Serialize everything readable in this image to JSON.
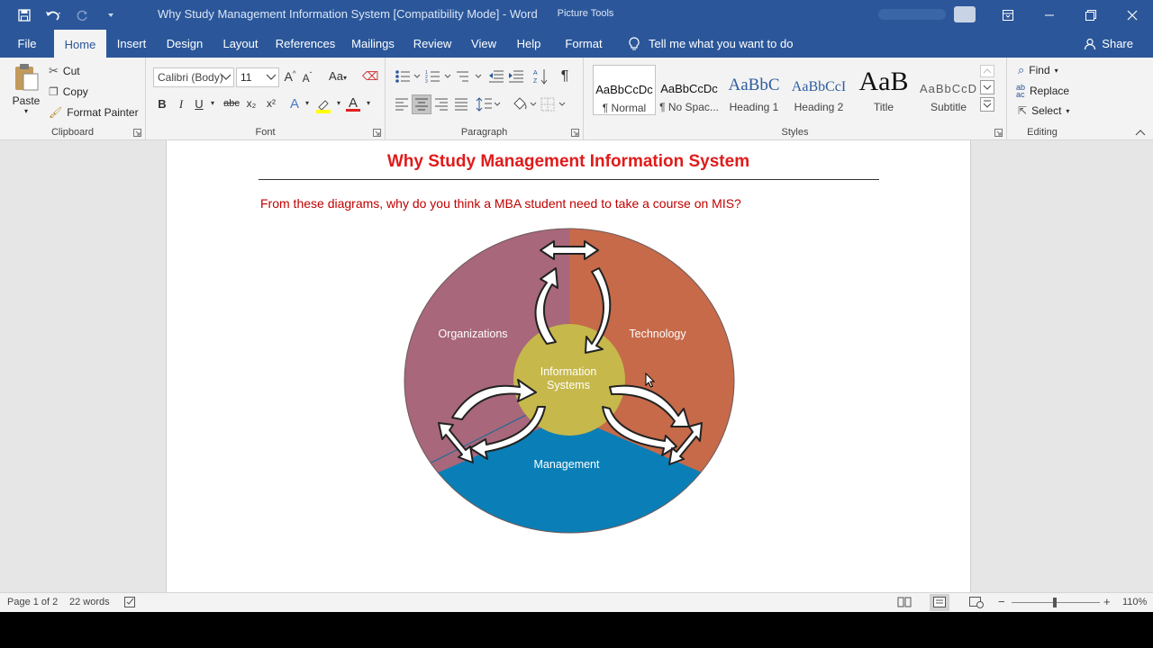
{
  "window": {
    "title": "Why Study Management Information System [Compatibility Mode]  -  Word",
    "context_tab_group": "Picture Tools"
  },
  "tabs": [
    {
      "label": "File"
    },
    {
      "label": "Home"
    },
    {
      "label": "Insert"
    },
    {
      "label": "Design"
    },
    {
      "label": "Layout"
    },
    {
      "label": "References"
    },
    {
      "label": "Mailings"
    },
    {
      "label": "Review"
    },
    {
      "label": "View"
    },
    {
      "label": "Help"
    },
    {
      "label": "Format"
    }
  ],
  "tell_me": "Tell me what you want to do",
  "share": "Share",
  "clipboard": {
    "paste": "Paste",
    "cut": "Cut",
    "copy": "Copy",
    "format_painter": "Format Painter",
    "label": "Clipboard"
  },
  "font": {
    "name": "Calibri (Body)",
    "size": "11",
    "case": "Aa",
    "label": "Font",
    "bold": "B",
    "italic": "I",
    "underline": "U",
    "strike": "abc",
    "sub": "x₂",
    "sup": "x²",
    "grow": "A",
    "shrink": "A",
    "effects": "A",
    "color_letter": "A"
  },
  "paragraph": {
    "label": "Paragraph"
  },
  "styles": {
    "label": "Styles",
    "items": [
      {
        "preview": "AaBbCcDc",
        "name": "¶ Normal"
      },
      {
        "preview": "AaBbCcDc",
        "name": "¶ No Spac..."
      },
      {
        "preview": "AaBbC",
        "name": "Heading 1"
      },
      {
        "preview": "AaBbCcI",
        "name": "Heading 2"
      },
      {
        "preview": "AaB",
        "name": "Title"
      },
      {
        "preview": "AaBbCcD",
        "name": "Subtitle"
      }
    ]
  },
  "editing": {
    "label": "Editing",
    "find": "Find",
    "replace": "Replace",
    "select": "Select"
  },
  "document": {
    "title": "Why Study Management Information System",
    "question": "From these diagrams, why do you think a MBA student need to take a course on MIS?",
    "diagram": {
      "organizations": "Organizations",
      "technology": "Technology",
      "management": "Management",
      "center_line1": "Information",
      "center_line2": "Systems",
      "colors": {
        "organizations": "#a8677b",
        "technology": "#c66a4a",
        "management": "#0a7fb7",
        "center": "#c6b84a"
      }
    }
  },
  "status": {
    "page": "Page 1 of 2",
    "words": "22 words",
    "zoom": "110%"
  }
}
